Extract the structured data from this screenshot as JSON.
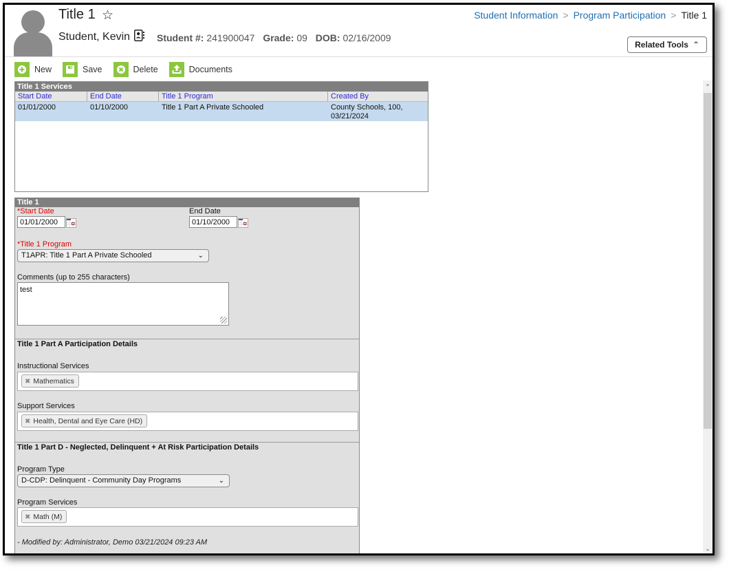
{
  "header": {
    "page_title": "Title 1",
    "student_name": "Student, Kevin",
    "student_number_label": "Student #:",
    "student_number": "241900047",
    "grade_label": "Grade:",
    "grade": "09",
    "dob_label": "DOB:",
    "dob": "02/16/2009",
    "breadcrumb": [
      "Student Information",
      "Program Participation",
      "Title 1"
    ],
    "related_tools_label": "Related Tools"
  },
  "toolbar": {
    "new_label": "New",
    "save_label": "Save",
    "delete_label": "Delete",
    "documents_label": "Documents"
  },
  "services_grid": {
    "caption": "Title 1 Services",
    "columns": [
      "Start Date",
      "End Date",
      "Title 1 Program",
      "Created By"
    ],
    "rows": [
      {
        "start_date": "01/01/2000",
        "end_date": "01/10/2000",
        "program": "Title 1 Part A Private Schooled",
        "created_by_line1": "County Schools, 100,",
        "created_by_line2": "03/21/2024"
      }
    ]
  },
  "form": {
    "caption": "Title 1",
    "start_date_label": "*Start Date",
    "start_date": "01/01/2000",
    "end_date_label": "End Date",
    "end_date": "01/10/2000",
    "program_label": "*Title 1 Program",
    "program_value": "T1APR: Title 1 Part A Private Schooled",
    "comments_label": "Comments (up to 255 characters)",
    "comments_value": "test",
    "part_a_title": "Title 1 Part A Participation Details",
    "instructional_label": "Instructional Services",
    "instructional_chips": [
      "Mathematics"
    ],
    "support_label": "Support Services",
    "support_chips": [
      "Health, Dental and Eye Care (HD)"
    ],
    "part_d_title": "Title 1 Part D - Neglected, Delinquent + At Risk Participation Details",
    "program_type_label": "Program Type",
    "program_type_value": "D-CDP: Delinquent - Community Day Programs",
    "program_services_label": "Program Services",
    "program_services_chips": [
      "Math (M)"
    ],
    "modified_text": "- Modified by: Administrator, Demo 03/21/2024 09:23 AM"
  },
  "colors": {
    "toolbar_icon_green": "#8cc63f",
    "link_blue": "#1f6fb2",
    "grid_header_text": "#2b2bd6",
    "selected_row": "#c5daee",
    "required_red": "#e00000"
  }
}
